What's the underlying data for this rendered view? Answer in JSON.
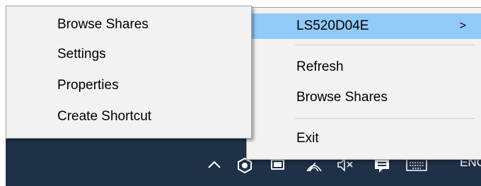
{
  "context_menu_left": {
    "items": [
      {
        "label": "Browse Shares"
      },
      {
        "label": "Settings"
      },
      {
        "label": "Properties"
      },
      {
        "label": "Create Shortcut"
      }
    ]
  },
  "context_menu_right": {
    "device": {
      "label": "LS520D04E",
      "submenu_indicator": ">"
    },
    "refresh_label": "Refresh",
    "browse_shares_label": "Browse Shares",
    "exit_label": "Exit"
  },
  "taskbar": {
    "language": "ENG",
    "tray_icons": [
      "chevron-up-icon",
      "nas-app-icon",
      "battery-icon",
      "wifi-icon",
      "volume-muted-icon",
      "action-center-icon",
      "keyboard-icon"
    ]
  },
  "colors": {
    "menu_background": "#f2f2f2",
    "highlight": "#91c9f7",
    "taskbar": "#1f3147"
  }
}
